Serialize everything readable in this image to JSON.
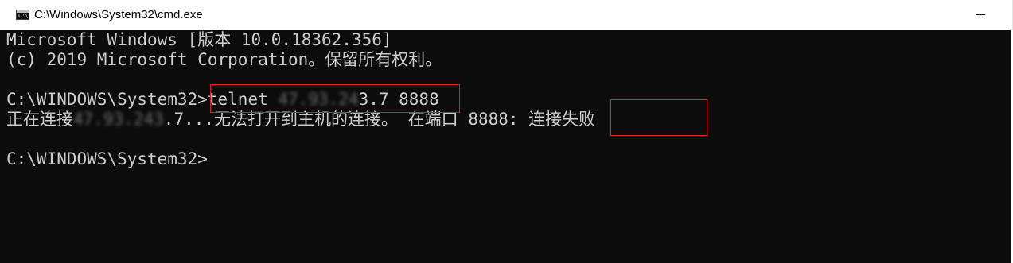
{
  "window": {
    "title": "C:\\Windows\\System32\\cmd.exe",
    "app_icon": "cmd-icon",
    "app_icon_glyph": "C:\\",
    "controls": {
      "minimize": "minimize-icon"
    }
  },
  "console": {
    "lines": [
      "Microsoft Windows [版本 10.0.18362.356]",
      "(c) 2019 Microsoft Corporation。保留所有权利。"
    ],
    "prompt": "C:\\WINDOWS\\System32>",
    "command": {
      "name": "telnet",
      "host_redacted": "47.93.24",
      "host_visible": "3.7",
      "port": "8888"
    },
    "output": {
      "prefix": "正在连接",
      "host_redacted": "47.93.243",
      "host_visible": ".7...",
      "message": "无法打开到主机的连接。",
      "port_label": "在端口 8888: ",
      "status": "连接失败"
    },
    "final_prompt": "C:\\WINDOWS\\System32>"
  },
  "colors": {
    "console_background": "#0c0c0c",
    "console_text": "#cccccc",
    "annotation_box": "#e02020"
  }
}
